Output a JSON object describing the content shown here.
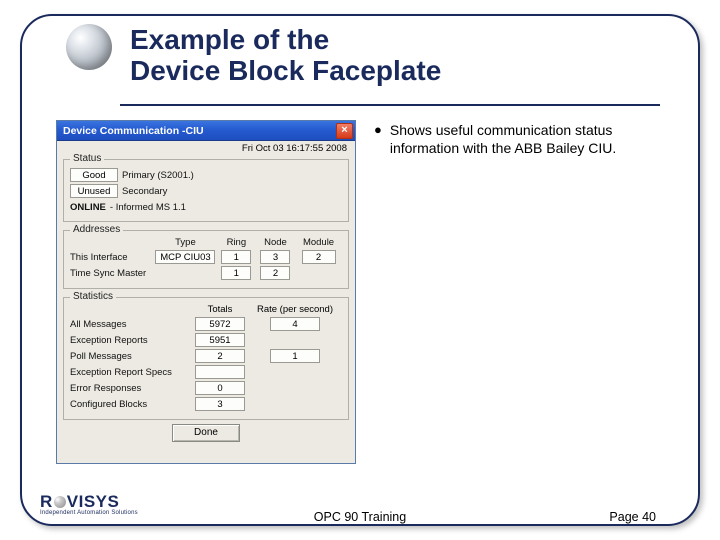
{
  "slide": {
    "title": "Example of the\nDevice Block Faceplate",
    "footer_center": "OPC 90 Training",
    "footer_right": "Page 40",
    "logo_name": "ROVISYS",
    "logo_sub": "Independent Automation Solutions"
  },
  "bullets": [
    "Shows useful communication status information with the ABB Bailey CIU."
  ],
  "faceplate": {
    "title_prefix": "Device Communication - ",
    "title_name": "CIU",
    "close_glyph": "×",
    "timestamp": "Fri Oct 03 16:17:55 2008",
    "status": {
      "group_label": "Status",
      "primary_state": "Good",
      "primary_label": "Primary (S2001.)",
      "secondary_state": "Unused",
      "secondary_label": "Secondary",
      "online_label": "ONLINE",
      "online_desc": " - Informed MS 1.1"
    },
    "addresses": {
      "group_label": "Addresses",
      "head_type": "Type",
      "head_ring": "Ring",
      "head_node": "Node",
      "head_module": "Module",
      "row1_label": "This Interface",
      "row1_type": "MCP CIU03",
      "row1_ring": "1",
      "row1_node": "3",
      "row1_module": "2",
      "row2_label": "Time Sync Master",
      "row2_ring": "1",
      "row2_node": "2"
    },
    "stats": {
      "group_label": "Statistics",
      "head_totals": "Totals",
      "head_rate": "Rate (per second)",
      "rows": [
        {
          "label": "All Messages",
          "total": "5972",
          "rate": "4"
        },
        {
          "label": "Exception Reports",
          "total": "5951",
          "rate": ""
        },
        {
          "label": "Poll Messages",
          "total": "2",
          "rate": "1"
        },
        {
          "label": "Exception Report Specs",
          "total": "",
          "rate": ""
        },
        {
          "label": "Error Responses",
          "total": "0",
          "rate": ""
        },
        {
          "label": "Configured Blocks",
          "total": "3",
          "rate": ""
        }
      ]
    },
    "done_label": "Done"
  }
}
